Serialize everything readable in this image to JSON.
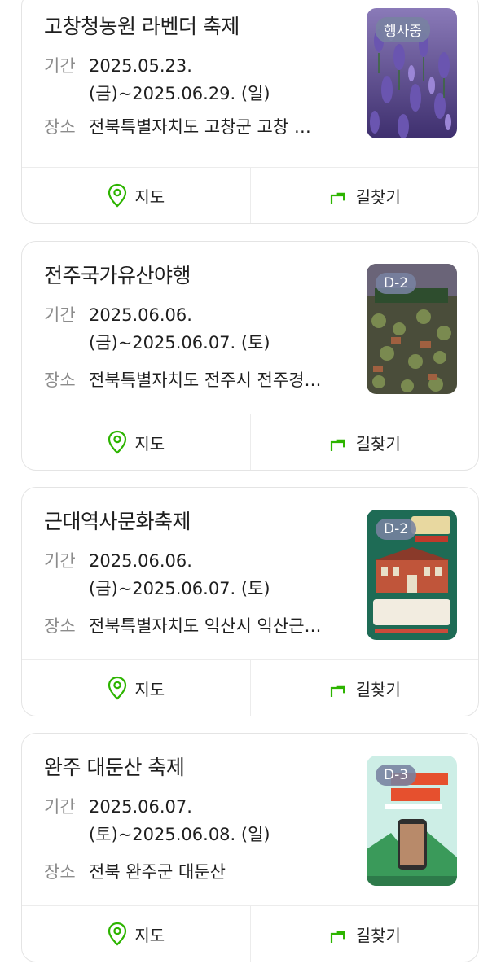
{
  "labels": {
    "period": "기간",
    "place": "장소",
    "map": "지도",
    "directions": "길찾기"
  },
  "colors": {
    "accent": "#2db400",
    "badge": "#7b84a3"
  },
  "events": [
    {
      "title": "고창청농원 라벤더 축제",
      "period": "2025.05.23. (금)~2025.06.29. (일)",
      "place": "전북특별자치도 고창군 고창 청농원",
      "badge": "행사중"
    },
    {
      "title": "전주국가유산야행",
      "period": "2025.06.06. (금)~2025.06.07. (토)",
      "place": "전북특별자치도 전주시 전주경기전",
      "badge": "D-2"
    },
    {
      "title": "근대역사문화축제",
      "period": "2025.06.06. (금)~2025.06.07. (토)",
      "place": "전북특별자치도 익산시 익산근대역사관",
      "badge": "D-2"
    },
    {
      "title": "완주 대둔산 축제",
      "period": "2025.06.07. (토)~2025.06.08. (일)",
      "place": "전북 완주군 대둔산",
      "badge": "D-3"
    }
  ]
}
